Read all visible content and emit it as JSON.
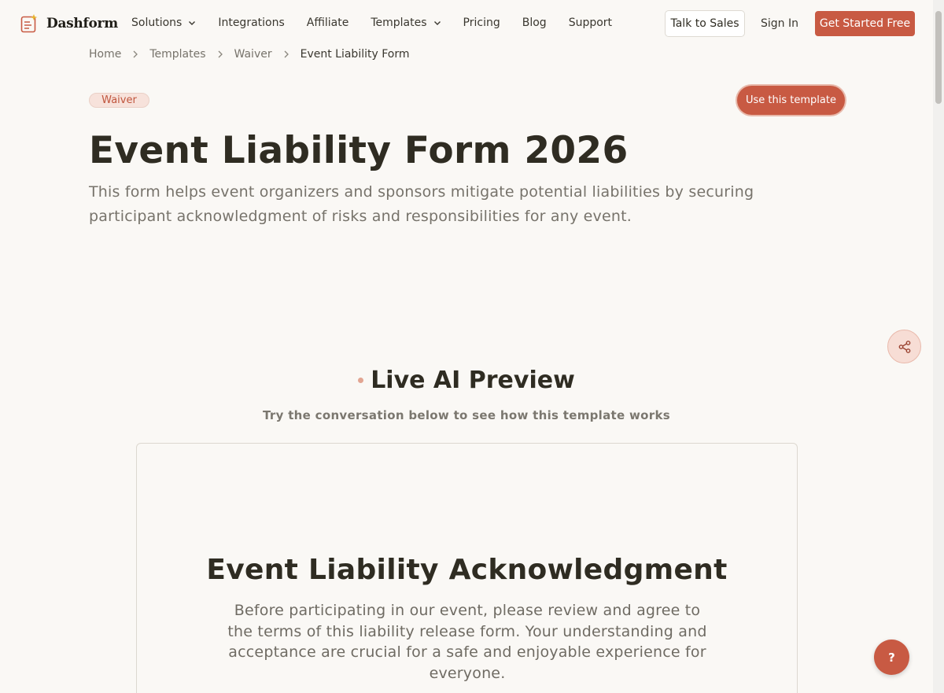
{
  "brand": {
    "name": "Dashform",
    "accent": "#c85a43"
  },
  "nav": {
    "items": [
      {
        "label": "Solutions",
        "has_dropdown": true
      },
      {
        "label": "Integrations",
        "has_dropdown": false
      },
      {
        "label": "Affiliate",
        "has_dropdown": false
      },
      {
        "label": "Templates",
        "has_dropdown": true
      },
      {
        "label": "Pricing",
        "has_dropdown": false
      },
      {
        "label": "Blog",
        "has_dropdown": false
      },
      {
        "label": "Support",
        "has_dropdown": false
      }
    ],
    "talk_to_sales": "Talk to Sales",
    "sign_in": "Sign In",
    "get_started": "Get Started Free"
  },
  "breadcrumb": [
    "Home",
    "Templates",
    "Waiver",
    "Event Liability Form"
  ],
  "hero": {
    "tag": "Waiver",
    "use_template": "Use this template",
    "title": "Event Liability Form 2026",
    "description": "This form helps event organizers and sponsors mitigate potential liabilities by securing participant acknowledgment of risks and responsibilities for any event."
  },
  "preview": {
    "title": "Live AI Preview",
    "subtitle": "Try the conversation below to see how this template works",
    "card_title": "Event Liability Acknowledgment",
    "card_description": "Before participating in our event, please review and agree to the terms of this liability release form. Your understanding and acceptance are crucial for a safe and enjoyable experience for everyone."
  },
  "floating": {
    "help_label": "?",
    "share_icon": "share-icon"
  }
}
